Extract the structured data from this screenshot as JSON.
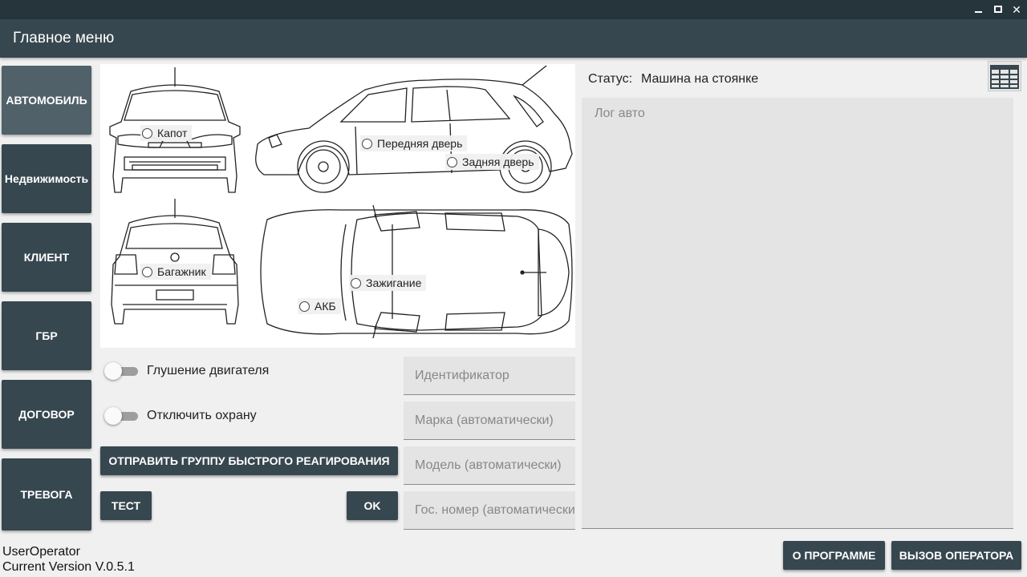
{
  "window": {
    "minimize_icon": "minimize-icon",
    "maximize_icon": "maximize-icon",
    "close_icon": "close-icon",
    "close_glyph": "✕"
  },
  "app": {
    "title": "Главное меню"
  },
  "sidebar": {
    "items": [
      {
        "label": "АВТОМОБИЛЬ",
        "active": true
      },
      {
        "label": "Недвижимость",
        "active": false
      },
      {
        "label": "КЛИЕНТ",
        "active": false
      },
      {
        "label": "ГБР",
        "active": false
      },
      {
        "label": "ДОГОВОР",
        "active": false
      },
      {
        "label": "ТРЕВОГА",
        "active": false
      }
    ]
  },
  "car_points": {
    "hood": "Капот",
    "front_door": "Передняя дверь",
    "rear_door": "Задняя дверь",
    "trunk": "Багажник",
    "ignition": "Зажигание",
    "battery": "АКБ"
  },
  "toggles": {
    "engine_kill": {
      "label": "Глушение двигателя",
      "on": false
    },
    "disarm": {
      "label": "Отключить охрану",
      "on": false
    }
  },
  "buttons": {
    "send_gbr": "ОТПРАВИТЬ ГРУППУ БЫСТРОГО РЕАГИРОВАНИЯ",
    "test": "ТЕСТ",
    "ok": "OK",
    "about": "О ПРОГРАММЕ",
    "call_operator": "ВЫЗОВ ОПЕРАТОРА"
  },
  "fields": {
    "identifier": {
      "value": "",
      "placeholder": "Идентификатор"
    },
    "brand": {
      "value": "",
      "placeholder": "Марка (автоматически)"
    },
    "model": {
      "value": "",
      "placeholder": "Модель (автоматически)"
    },
    "plate": {
      "value": "",
      "placeholder": "Гос. номер (автоматически)"
    }
  },
  "status": {
    "label": "Статус:",
    "value": "Машина на стоянке"
  },
  "log": {
    "placeholder": "Лог авто"
  },
  "footer": {
    "user": "UserOperator",
    "version": "Current Version V.0.5.1"
  },
  "colors": {
    "primary": "#37474f",
    "primary_active": "#50616a",
    "titlebar": "#26343b",
    "field_bg": "#e4e4e4"
  }
}
